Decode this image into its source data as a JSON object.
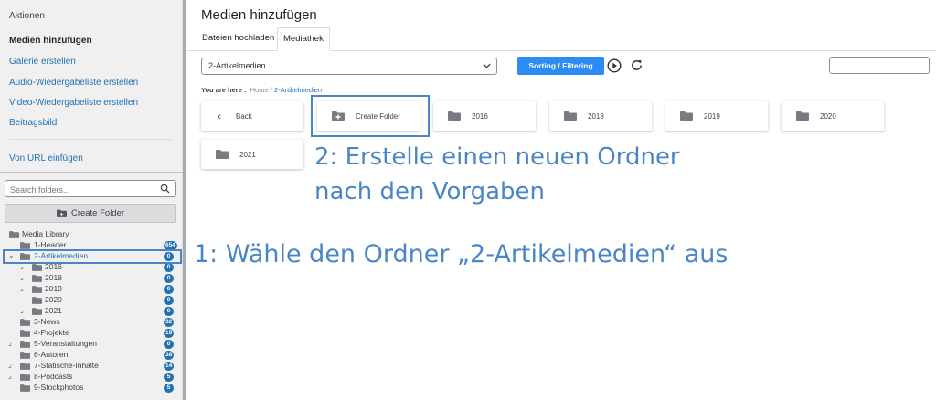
{
  "sidebar": {
    "title": "Aktionen",
    "links": [
      {
        "label": "Medien hinzufügen",
        "active": true
      },
      {
        "label": "Galerie erstellen",
        "active": false
      },
      {
        "label": "Audio-Wiedergabeliste erstellen",
        "active": false
      },
      {
        "label": "Video-Wiedergabeliste erstellen",
        "active": false
      },
      {
        "label": "Beitragsbild",
        "active": false
      },
      {
        "label": "Von URL einfügen",
        "active": false
      }
    ],
    "search_placeholder": "Search folders...",
    "create_folder_label": "Create Folder",
    "tree": [
      {
        "label": "Media Library",
        "level": 0,
        "toggle": "",
        "badge": ""
      },
      {
        "label": "1-Header",
        "level": 1,
        "toggle": "",
        "badge": "654"
      },
      {
        "label": "2-Artikelmedien",
        "level": 1,
        "toggle": "⌄",
        "badge": "0",
        "selected": true
      },
      {
        "label": "2016",
        "level": 2,
        "toggle": "⌟",
        "badge": "0"
      },
      {
        "label": "2018",
        "level": 2,
        "toggle": "⌟",
        "badge": "0"
      },
      {
        "label": "2019",
        "level": 2,
        "toggle": "⌟",
        "badge": "0"
      },
      {
        "label": "2020",
        "level": 2,
        "toggle": "",
        "badge": "0"
      },
      {
        "label": "2021",
        "level": 2,
        "toggle": "⌟",
        "badge": "0"
      },
      {
        "label": "3-News",
        "level": 1,
        "toggle": "",
        "badge": "32"
      },
      {
        "label": "4-Projekte",
        "level": 1,
        "toggle": "",
        "badge": "19"
      },
      {
        "label": "5-Veranstaltungen",
        "level": 1,
        "toggle": "⌟",
        "badge": "0"
      },
      {
        "label": "6-Autoren",
        "level": 1,
        "toggle": "",
        "badge": "38"
      },
      {
        "label": "7-Statische-Inhalte",
        "level": 1,
        "toggle": "⌟",
        "badge": "14"
      },
      {
        "label": "8-Podcasts",
        "level": 1,
        "toggle": "⌟",
        "badge": "5"
      },
      {
        "label": "9-Stockphotos",
        "level": 1,
        "toggle": "",
        "badge": "5"
      }
    ]
  },
  "main": {
    "title": "Medien hinzufügen",
    "tabs": [
      {
        "label": "Dateien hochladen",
        "active": false
      },
      {
        "label": "Mediathek",
        "active": true
      }
    ],
    "folder_select_value": "2-Artikelmedien",
    "sort_button_label": "Sorting / Filtering",
    "breadcrumb": {
      "prefix": "You are here :",
      "items": [
        "Home",
        "/",
        "2-Artikelmedien"
      ]
    },
    "cards": [
      {
        "kind": "back",
        "label": "Back"
      },
      {
        "kind": "create",
        "label": "Create Folder"
      },
      {
        "kind": "folder",
        "label": "2016"
      },
      {
        "kind": "folder",
        "label": "2018"
      },
      {
        "kind": "folder",
        "label": "2019"
      },
      {
        "kind": "folder",
        "label": "2020"
      },
      {
        "kind": "folder",
        "label": "2021"
      }
    ]
  },
  "annotations": {
    "step2_line1": "2: Erstelle einen neuen Ordner",
    "step2_line2": "nach den Vorgaben",
    "step1": "1: Wähle den Ordner „2-Artikelmedien“ aus"
  },
  "colors": {
    "accent": "#2271b1",
    "annotation": "#4a86c5",
    "sort_button": "#2c8cf4",
    "folder_icon": "#787c82"
  }
}
